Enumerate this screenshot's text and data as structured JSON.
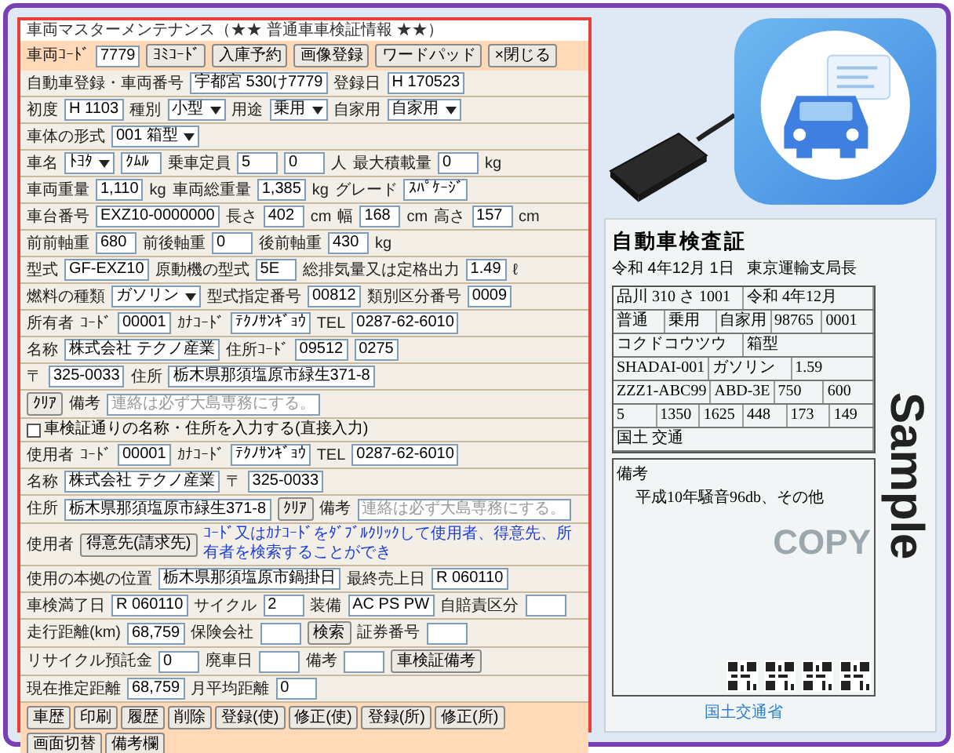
{
  "form": {
    "title": "車両マスターメンテナンス（★★ 普通車車検証情報 ★★）",
    "toolbar": [
      {
        "kind": "label",
        "text": "車両ｺｰﾄﾞ"
      },
      {
        "kind": "field",
        "text": "7779"
      },
      {
        "kind": "button",
        "text": "ﾖﾐｺｰﾄﾞ"
      },
      {
        "kind": "button",
        "text": "入庫予約"
      },
      {
        "kind": "button",
        "text": "画像登録"
      },
      {
        "kind": "button",
        "text": "ワードパッド"
      },
      {
        "kind": "button",
        "text": "×閉じる"
      }
    ],
    "rows": [
      {
        "cells": [
          {
            "kind": "label",
            "text": "自動車登録・車両番号"
          },
          {
            "kind": "field",
            "text": "宇都宮 530け7779"
          },
          {
            "kind": "label",
            "text": "登録日"
          },
          {
            "kind": "field",
            "text": "H 170523"
          }
        ]
      },
      {
        "cells": [
          {
            "kind": "label",
            "text": "初度"
          },
          {
            "kind": "field",
            "text": "H 1103"
          },
          {
            "kind": "label",
            "text": "種別"
          },
          {
            "kind": "select",
            "text": "小型"
          },
          {
            "kind": "label",
            "text": "用途"
          },
          {
            "kind": "select",
            "text": "乗用"
          },
          {
            "kind": "label",
            "text": "自家用"
          },
          {
            "kind": "select",
            "text": "自家用"
          }
        ]
      },
      {
        "cells": [
          {
            "kind": "label",
            "text": "車体の形式"
          },
          {
            "kind": "select",
            "text": "001 箱型"
          }
        ]
      },
      {
        "cells": [
          {
            "kind": "label",
            "text": "車名"
          },
          {
            "kind": "select",
            "text": "ﾄﾖﾀ"
          },
          {
            "kind": "field",
            "text": "ｸﾑﾙ"
          },
          {
            "kind": "label",
            "text": "乗車定員"
          },
          {
            "kind": "field",
            "text": "5"
          },
          {
            "kind": "field",
            "text": "0"
          },
          {
            "kind": "label",
            "text": "人"
          },
          {
            "kind": "label",
            "text": "最大積載量"
          },
          {
            "kind": "field",
            "text": "0"
          },
          {
            "kind": "label",
            "text": "kg"
          }
        ]
      },
      {
        "cells": [
          {
            "kind": "label",
            "text": "車両重量"
          },
          {
            "kind": "field",
            "text": "1,110"
          },
          {
            "kind": "label",
            "text": "kg"
          },
          {
            "kind": "label",
            "text": "車両総重量"
          },
          {
            "kind": "field",
            "text": "1,385"
          },
          {
            "kind": "label",
            "text": "kg"
          },
          {
            "kind": "label",
            "text": "グレード"
          },
          {
            "kind": "field",
            "text": "ｽﾊﾟｹｰｼﾞ"
          }
        ]
      },
      {
        "cells": [
          {
            "kind": "label",
            "text": "車台番号"
          },
          {
            "kind": "field",
            "text": "EXZ10-0000000"
          },
          {
            "kind": "label",
            "text": "長さ"
          },
          {
            "kind": "field",
            "text": "402"
          },
          {
            "kind": "label",
            "text": "cm"
          },
          {
            "kind": "label",
            "text": "幅"
          },
          {
            "kind": "field",
            "text": "168"
          },
          {
            "kind": "label",
            "text": "cm"
          },
          {
            "kind": "label",
            "text": "高さ"
          },
          {
            "kind": "field",
            "text": "157"
          },
          {
            "kind": "label",
            "text": "cm"
          }
        ]
      },
      {
        "cells": [
          {
            "kind": "label",
            "text": "前前軸重"
          },
          {
            "kind": "field",
            "text": "680"
          },
          {
            "kind": "label",
            "text": "前後軸重"
          },
          {
            "kind": "field",
            "text": "0"
          },
          {
            "kind": "label",
            "text": "後前軸重"
          },
          {
            "kind": "field",
            "text": "430"
          },
          {
            "kind": "label",
            "text": "kg"
          }
        ]
      },
      {
        "cells": [
          {
            "kind": "label",
            "text": "型式"
          },
          {
            "kind": "field",
            "text": "GF-EXZ10"
          },
          {
            "kind": "label",
            "text": "原動機の型式"
          },
          {
            "kind": "field",
            "text": "5E"
          },
          {
            "kind": "label",
            "text": "総排気量又は定格出力"
          },
          {
            "kind": "field",
            "text": "1.49"
          },
          {
            "kind": "label",
            "text": "ℓ"
          }
        ]
      },
      {
        "cells": [
          {
            "kind": "label",
            "text": "燃料の種類"
          },
          {
            "kind": "select",
            "text": "ガソリン"
          },
          {
            "kind": "label",
            "text": "型式指定番号"
          },
          {
            "kind": "field",
            "text": "00812"
          },
          {
            "kind": "label",
            "text": "類別区分番号"
          },
          {
            "kind": "field",
            "text": "0009"
          }
        ]
      },
      {
        "cells": [
          {
            "kind": "label",
            "text": "所有者"
          },
          {
            "kind": "label",
            "text": "ｺｰﾄﾞ"
          },
          {
            "kind": "field",
            "text": "00001"
          },
          {
            "kind": "label",
            "text": "ｶﾅｺｰﾄﾞ"
          },
          {
            "kind": "field",
            "text": "ﾃｸﾉｻﾝｷﾞｮｳ"
          },
          {
            "kind": "label",
            "text": "TEL"
          },
          {
            "kind": "field",
            "text": "0287-62-6010"
          }
        ]
      },
      {
        "cells": [
          {
            "kind": "label",
            "text": "名称"
          },
          {
            "kind": "field",
            "text": "株式会社 テクノ産業"
          },
          {
            "kind": "label",
            "text": "住所ｺｰﾄﾞ"
          },
          {
            "kind": "field",
            "text": "09512"
          },
          {
            "kind": "field",
            "text": "0275"
          }
        ]
      },
      {
        "cells": [
          {
            "kind": "label",
            "text": "〒"
          },
          {
            "kind": "field",
            "text": "325-0033"
          },
          {
            "kind": "label",
            "text": "住所"
          },
          {
            "kind": "field",
            "text": "栃木県那須塩原市緑生371-8"
          }
        ]
      },
      {
        "cells": [
          {
            "kind": "button",
            "text": "ｸﾘｱ"
          },
          {
            "kind": "label",
            "text": "備考"
          },
          {
            "kind": "dim",
            "text": "連絡は必ず大島専務にする。"
          }
        ]
      },
      {
        "cells": [
          {
            "kind": "check",
            "text": "車検証通りの名称・住所を入力する(直接入力)",
            "checked": false
          }
        ]
      },
      {
        "cells": [
          {
            "kind": "label",
            "text": "使用者"
          },
          {
            "kind": "label",
            "text": "ｺｰﾄﾞ"
          },
          {
            "kind": "field",
            "text": "00001"
          },
          {
            "kind": "label",
            "text": "ｶﾅｺｰﾄﾞ"
          },
          {
            "kind": "field",
            "text": "ﾃｸﾉｻﾝｷﾞｮｳ"
          },
          {
            "kind": "label",
            "text": "TEL"
          },
          {
            "kind": "field",
            "text": "0287-62-6010"
          }
        ]
      },
      {
        "cells": [
          {
            "kind": "label",
            "text": "名称"
          },
          {
            "kind": "field",
            "text": "株式会社 テクノ産業"
          },
          {
            "kind": "label",
            "text": "〒"
          },
          {
            "kind": "field",
            "text": "325-0033"
          }
        ]
      },
      {
        "cells": [
          {
            "kind": "label",
            "text": "住所"
          },
          {
            "kind": "field",
            "text": "栃木県那須塩原市緑生371-8"
          },
          {
            "kind": "button",
            "text": "ｸﾘｱ"
          },
          {
            "kind": "label",
            "text": "備考"
          },
          {
            "kind": "dim",
            "text": "連絡は必ず大島専務にする。"
          }
        ]
      },
      {
        "cells": [
          {
            "kind": "label",
            "text": "使用者"
          },
          {
            "kind": "button",
            "text": "得意先(請求先)"
          },
          {
            "kind": "note",
            "text": "ｺｰﾄﾞ又はｶﾅｺｰﾄﾞをﾀﾞﾌﾞﾙｸﾘｯｸして使用者、得意先、所有者を検索することができ"
          }
        ]
      },
      {
        "cells": [
          {
            "kind": "label",
            "text": "使用の本拠の位置"
          },
          {
            "kind": "field",
            "text": "栃木県那須塩原市鍋掛日"
          },
          {
            "kind": "label",
            "text": "最終売上日"
          },
          {
            "kind": "field",
            "text": "R 060110"
          }
        ]
      },
      {
        "cells": [
          {
            "kind": "label",
            "text": "車検満了日"
          },
          {
            "kind": "field",
            "text": "R 060110"
          },
          {
            "kind": "label",
            "text": "サイクル"
          },
          {
            "kind": "field",
            "text": "2"
          },
          {
            "kind": "label",
            "text": "装備"
          },
          {
            "kind": "field",
            "text": "AC PS PW"
          },
          {
            "kind": "label",
            "text": "自賠責区分"
          },
          {
            "kind": "field"
          }
        ]
      },
      {
        "cells": [
          {
            "kind": "label",
            "text": "走行距離(km)"
          },
          {
            "kind": "field",
            "text": "68,759"
          },
          {
            "kind": "label",
            "text": "保険会社"
          },
          {
            "kind": "field"
          },
          {
            "kind": "button",
            "text": "検索"
          },
          {
            "kind": "label",
            "text": "証券番号"
          },
          {
            "kind": "field"
          }
        ]
      },
      {
        "cells": [
          {
            "kind": "label",
            "text": "リサイクル預託金"
          },
          {
            "kind": "field",
            "text": "0"
          },
          {
            "kind": "label",
            "text": "廃車日"
          },
          {
            "kind": "field"
          },
          {
            "kind": "label",
            "text": "備考"
          },
          {
            "kind": "field"
          },
          {
            "kind": "button",
            "text": "車検証備考"
          }
        ]
      },
      {
        "cells": [
          {
            "kind": "label",
            "text": "現在推定距離"
          },
          {
            "kind": "field",
            "text": "68,759"
          },
          {
            "kind": "label",
            "text": "月平均距離"
          },
          {
            "kind": "field",
            "text": "0"
          }
        ]
      }
    ],
    "footer": [
      {
        "kind": "button",
        "text": "車歴"
      },
      {
        "kind": "button",
        "text": "印刷"
      },
      {
        "kind": "button",
        "text": "履歴"
      },
      {
        "kind": "button",
        "text": "削除"
      },
      {
        "kind": "button",
        "text": "登録(使)"
      },
      {
        "kind": "button",
        "text": "修正(使)"
      },
      {
        "kind": "button",
        "text": "登録(所)"
      },
      {
        "kind": "button",
        "text": "修正(所)"
      },
      {
        "kind": "button",
        "text": "画面切替"
      },
      {
        "kind": "button",
        "text": "備考欄"
      }
    ]
  },
  "certificate": {
    "title": "自動車検査証",
    "date": "令和 4年12月 1日",
    "issuer": "東京運輸支局長",
    "rows": [
      {
        "items": [
          "品川 310 さ 1001",
          "令和 4年12月"
        ]
      },
      {
        "items": [
          "普通",
          "乗用",
          "自家用",
          "98765",
          "0001"
        ]
      },
      {
        "items": [
          "コクドコウツウ",
          "箱型"
        ]
      },
      {
        "items": [
          "SHADAI-001",
          "ガソリン",
          "1.59"
        ]
      },
      {
        "items": [
          "ZZZ1-ABC99",
          "ABD-3E",
          "750",
          "600"
        ]
      },
      {
        "items": [
          "5",
          "1350",
          "1625",
          "448",
          "173",
          "149"
        ]
      },
      {
        "items": [
          "国土 交通"
        ]
      }
    ],
    "remarks_label": "備考",
    "remarks": "平成10年騒音96db、その他",
    "stamp": "Sample",
    "copy": "COPY",
    "footer": "国土交通省"
  }
}
